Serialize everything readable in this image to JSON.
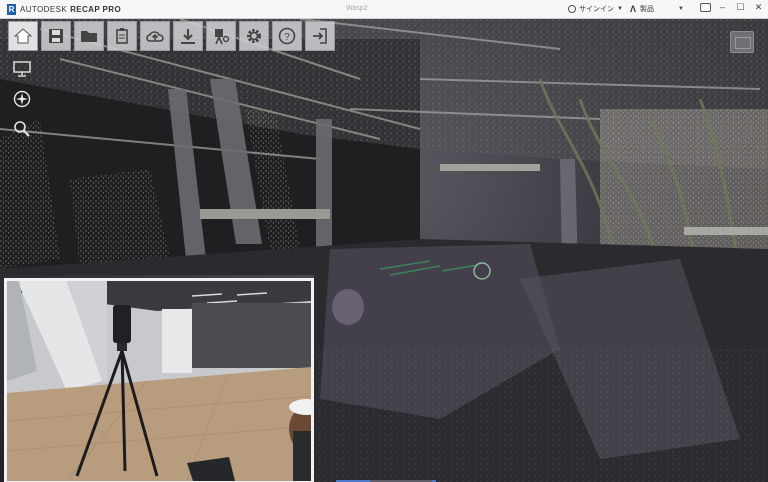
{
  "titlebar": {
    "logo_letter": "R",
    "brand_name": "AUTODESK",
    "brand_product": "RECAP PRO",
    "document_title": "Wasp2",
    "signin_label": "サインイン",
    "product_label": "製品"
  },
  "toolbar": {
    "buttons": [
      {
        "name": "home",
        "icon": "home-icon"
      },
      {
        "name": "save",
        "icon": "save-icon"
      },
      {
        "name": "open",
        "icon": "folder-icon"
      },
      {
        "name": "project-tools",
        "icon": "clipboard-icon"
      },
      {
        "name": "upload",
        "icon": "cloud-upload-icon"
      },
      {
        "name": "export",
        "icon": "download-icon"
      },
      {
        "name": "measure",
        "icon": "survey-icon"
      },
      {
        "name": "settings",
        "icon": "gear-icon"
      },
      {
        "name": "help",
        "icon": "help-icon"
      },
      {
        "name": "exit",
        "icon": "exit-icon"
      }
    ]
  },
  "colors": {
    "accent": "#4b78c8",
    "toolbar_bg": "#d2d2d6",
    "titlebar_bg": "#f7f7f7"
  }
}
